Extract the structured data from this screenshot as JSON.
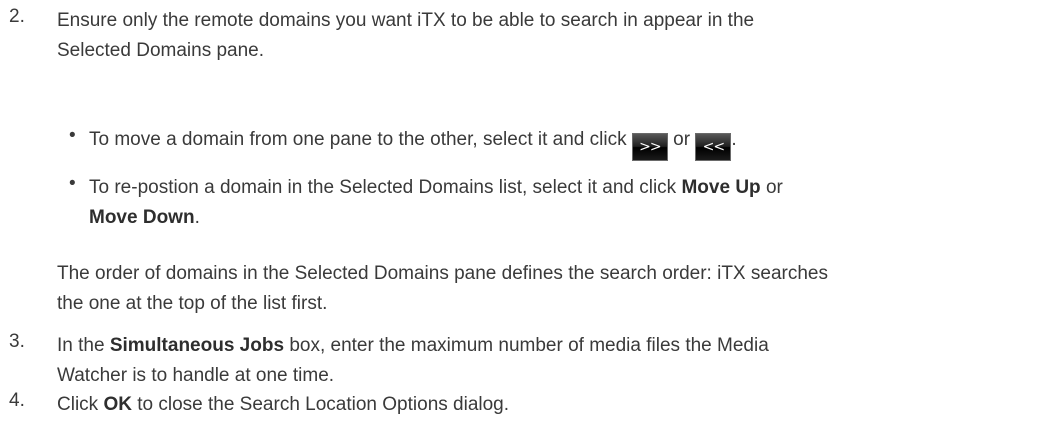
{
  "steps": [
    {
      "number": "2.",
      "lines": [
        "Ensure only the remote domains you want iTX to be able to search in appear in the",
        "Selected Domains pane."
      ],
      "bullets": [
        {
          "prefix": "To move a domain from one pane to the other, select it and click",
          "button1": ">>",
          "connector": "or",
          "button2": "<<",
          "suffix": "."
        },
        {
          "line1_prefix": "To re-postion a domain in the Selected Domains list, select it and click",
          "move_up": "Move Up",
          "or": "or",
          "move_down": "Move Down",
          "end": "."
        }
      ],
      "note_lines": [
        "The order of domains in the Selected Domains pane defines the search order: iTX searches",
        "the one at the top of the list first."
      ]
    },
    {
      "number": "3.",
      "prefix": "In the",
      "bold": "Simultaneous Jobs",
      "line1_suffix": "box, enter the maximum number of media files the Media",
      "line2": "Watcher is to handle at one time."
    },
    {
      "number": "4.",
      "prefix": "Click",
      "bold": "OK",
      "suffix": "to close the Search Location Options dialog."
    }
  ],
  "bullet_glyph": "•"
}
